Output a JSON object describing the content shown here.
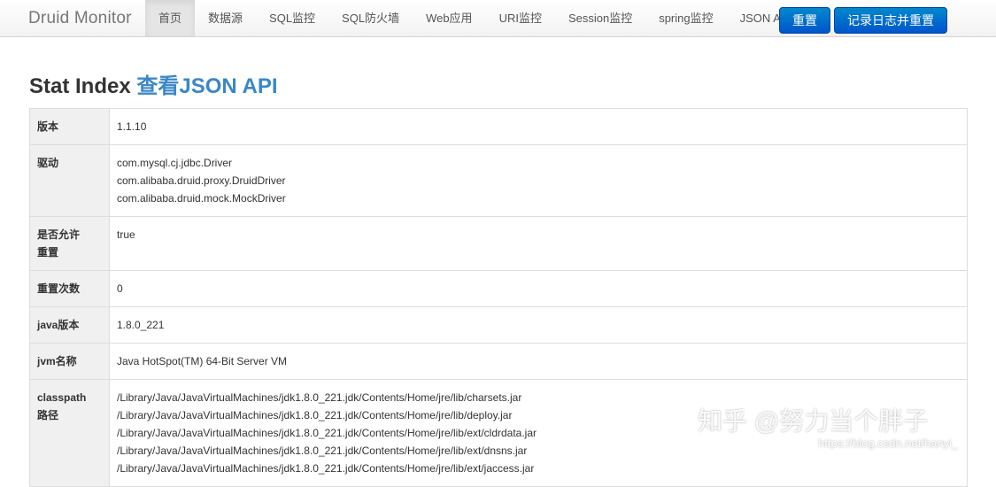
{
  "navbar": {
    "brand": "Druid Monitor",
    "items": [
      {
        "label": "首页",
        "active": true
      },
      {
        "label": "数据源"
      },
      {
        "label": "SQL监控"
      },
      {
        "label": "SQL防火墙"
      },
      {
        "label": "Web应用"
      },
      {
        "label": "URI监控"
      },
      {
        "label": "Session监控"
      },
      {
        "label": "spring监控"
      },
      {
        "label": "JSON API"
      }
    ],
    "reset_label": "重置",
    "log_reset_label": "记录日志并重置"
  },
  "page": {
    "title": "Stat Index",
    "title_link": "查看JSON API"
  },
  "stats": {
    "version": {
      "key": "版本",
      "value": "1.1.10"
    },
    "drivers": {
      "key": "驱动",
      "values": [
        "com.mysql.cj.jdbc.Driver",
        "com.alibaba.druid.proxy.DruidDriver",
        "com.alibaba.druid.mock.MockDriver"
      ]
    },
    "reset_enable": {
      "key_line1": "是否允许",
      "key_line2": "重置",
      "value": "true"
    },
    "reset_count": {
      "key": "重置次数",
      "value": "0"
    },
    "java_version": {
      "key": "java版本",
      "value": "1.8.0_221"
    },
    "jvm_name": {
      "key": "jvm名称",
      "value": "Java HotSpot(TM) 64-Bit Server VM"
    },
    "classpath": {
      "key_line1": "classpath",
      "key_line2": "路径",
      "values": [
        "/Library/Java/JavaVirtualMachines/jdk1.8.0_221.jdk/Contents/Home/jre/lib/charsets.jar",
        "/Library/Java/JavaVirtualMachines/jdk1.8.0_221.jdk/Contents/Home/jre/lib/deploy.jar",
        "/Library/Java/JavaVirtualMachines/jdk1.8.0_221.jdk/Contents/Home/jre/lib/ext/cldrdata.jar",
        "/Library/Java/JavaVirtualMachines/jdk1.8.0_221.jdk/Contents/Home/jre/lib/ext/dnsns.jar",
        "/Library/Java/JavaVirtualMachines/jdk1.8.0_221.jdk/Contents/Home/jre/lib/ext/jaccess.jar"
      ]
    }
  },
  "watermark": {
    "text": "知乎 @努力当个胖子",
    "url": "https://blog.csdn.net/hanyi_"
  },
  "colors": {
    "accent": "#0070cc",
    "link": "#3a87c8",
    "key_bg": "#f0f0f0"
  }
}
